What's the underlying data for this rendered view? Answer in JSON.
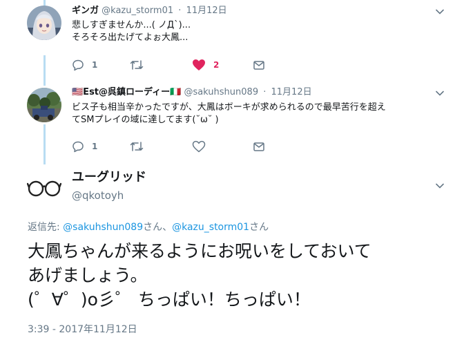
{
  "colors": {
    "accent": "#1b95e0",
    "secondary_text": "#657786",
    "like": "#e0245e",
    "thread_line": "#b8dcf2"
  },
  "tweets": [
    {
      "display_name": "ギンガ",
      "handle": "@kazu_storm01",
      "time": "11月12日",
      "lines": [
        "悲しすぎませんか...( ノД`)...",
        "そろそろ出たげてよぉ大鳳..."
      ],
      "reply_count": "1",
      "retweet_count": "",
      "like_count": "2",
      "liked": true
    },
    {
      "display_name": "🇺🇸Est@呉鎮ローディー🇮🇹",
      "handle": "@sakuhshun089",
      "time": "11月12日",
      "lines": [
        "ビス子も相当辛かったですが、大鳳はボーキが求められるので最早苦行を超え",
        "てSMプレイの域に達してます(˘ω˘ )"
      ],
      "reply_count": "1",
      "retweet_count": "",
      "like_count": "",
      "liked": false
    }
  ],
  "main_tweet": {
    "display_name": "ユーグリッド",
    "handle": "@qkotoyh",
    "reply_prefix": "返信先: ",
    "mentions": [
      "@sakuhshun089",
      "@kazu_storm01"
    ],
    "mention_suffix": "さん",
    "mention_separator": "、",
    "lines": [
      "大鳳ちゃんが来るようにお呪いをしておいて",
      "あげましょう。",
      "(゜∀゜)o彡゜ ちっぱい！ちっぱい！"
    ],
    "timestamp": "3:39 - 2017年11月12日"
  },
  "icons": {
    "reply": "reply-icon",
    "retweet": "retweet-icon",
    "like": "heart-icon",
    "dm": "envelope-icon",
    "more": "chevron-down-icon"
  }
}
